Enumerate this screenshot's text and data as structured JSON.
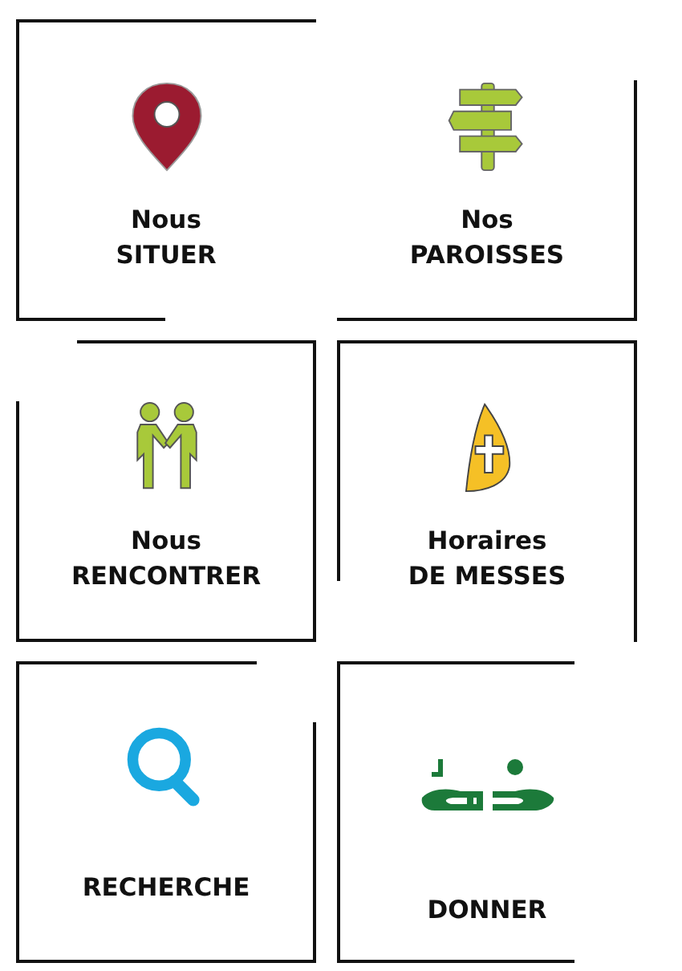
{
  "tiles": [
    {
      "kind": "pin",
      "lines": [
        "Nous",
        "SITUER"
      ]
    },
    {
      "kind": "signpost",
      "lines": [
        "Nos",
        "PAROISSES"
      ]
    },
    {
      "kind": "handshake",
      "lines": [
        "Nous",
        "RENCONTRER"
      ]
    },
    {
      "kind": "mitre",
      "lines": [
        "Horaires",
        "DE MESSES"
      ]
    },
    {
      "kind": "search",
      "lines": [
        "RECHERCHE"
      ]
    },
    {
      "kind": "donate",
      "lines": [
        "DONNER"
      ]
    }
  ]
}
